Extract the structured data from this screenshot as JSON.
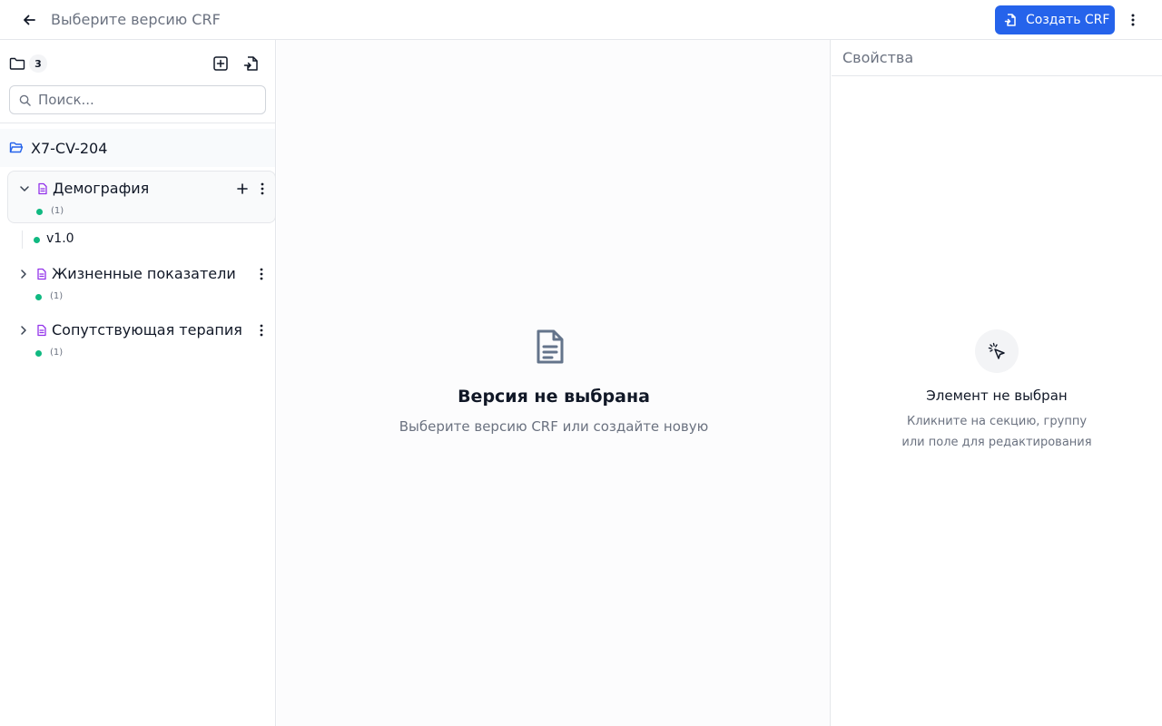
{
  "header": {
    "title": "Выберите версию CRF",
    "create_button_label": "Создать CRF"
  },
  "sidebar": {
    "count_badge": "3",
    "search_placeholder": "Поиск...",
    "project": {
      "name": "X7-CV-204"
    },
    "crfs": [
      {
        "name": "Демография",
        "count": "(1)",
        "expanded": true,
        "versions": [
          {
            "label": "v1.0",
            "status_color": "#10b981"
          }
        ]
      },
      {
        "name": "Жизненные показатели",
        "count": "(1)",
        "expanded": false
      },
      {
        "name": "Сопутствующая терапия",
        "count": "(1)",
        "expanded": false
      }
    ]
  },
  "main": {
    "empty_title": "Версия не выбрана",
    "empty_subtitle": "Выберите версию CRF или создайте новую"
  },
  "properties": {
    "title": "Свойства",
    "empty_title": "Элемент не выбран",
    "empty_subtitle": "Кликните на секцию, группу или поле для редактирования"
  },
  "colors": {
    "accent": "#2563eb",
    "status_dot": "#10b981",
    "doc_icon": "#9333ea",
    "folder_open_icon": "#2563eb"
  }
}
